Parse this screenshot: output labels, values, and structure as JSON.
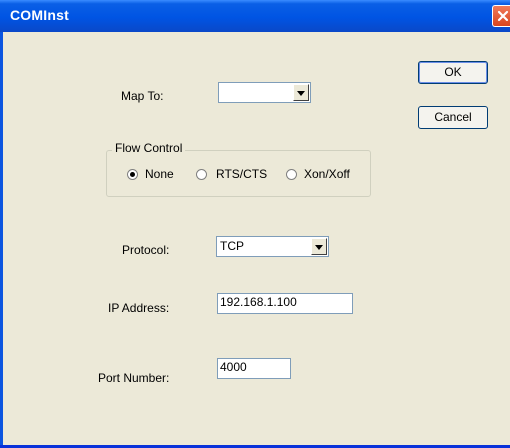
{
  "window": {
    "title": "COMInst"
  },
  "map_to": {
    "label": "Map To:",
    "value": ""
  },
  "flow_control": {
    "title": "Flow Control",
    "options": [
      "None",
      "RTS/CTS",
      "Xon/Xoff"
    ],
    "selected": "None"
  },
  "protocol": {
    "label": "Protocol:",
    "value": "TCP"
  },
  "ip_address": {
    "label": "IP Address:",
    "value": "192.168.1.100"
  },
  "port_number": {
    "label": "Port Number:",
    "value": "4000"
  },
  "buttons": {
    "ok": "OK",
    "cancel": "Cancel"
  },
  "colors": {
    "titlebar": "#0054e3",
    "client": "#ece9d8",
    "close": "#d8451f"
  }
}
